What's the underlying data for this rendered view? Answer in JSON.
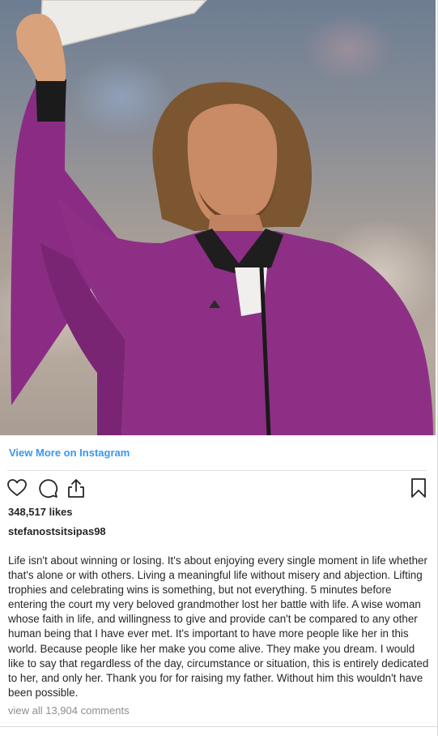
{
  "post": {
    "view_more_link": "View More on Instagram",
    "likes": "348,517 likes",
    "username": "stefanostsitsipas98",
    "caption": "Life isn't about winning or losing. It's about enjoying every single moment in life whether that's alone or with others. Living a meaningful life without misery and abjection. Lifting trophies and celebrating wins is something, but not everything. 5 minutes before entering the court my very beloved grandmother lost her battle with life. A wise woman whose faith in life, and willingness to give and provide can't be compared to any other human being that I have ever met. It's important to have more people like her in this world. Because people like her make you come alive. They make you dream. I would like to say that regardless of the day, circumstance or situation, this is entirely dedicated to her, and only her. Thank you for for raising my father. Without him this wouldn't have been possible.",
    "view_comments": "view all 13,904 comments"
  },
  "icons": {
    "like": "heart-icon",
    "comment": "comment-icon",
    "share": "share-icon",
    "save": "bookmark-icon"
  },
  "colors": {
    "link": "#3897f0",
    "text": "#262626",
    "muted": "#8e8e8e",
    "jacket": "#8e2f86"
  }
}
